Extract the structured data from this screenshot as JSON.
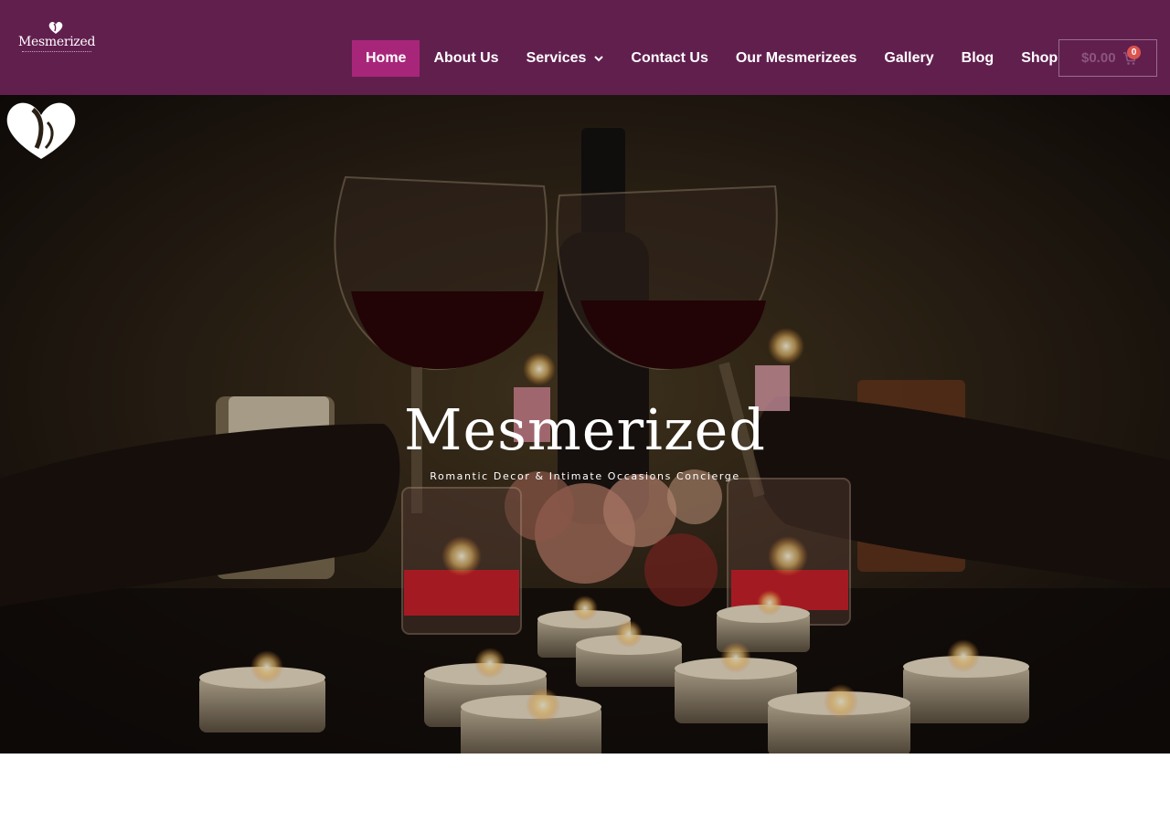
{
  "header": {
    "logo": {
      "name": "Mesmerized",
      "icon": "heart-swirl-logo"
    },
    "nav": [
      {
        "label": "Home",
        "active": true
      },
      {
        "label": "About Us"
      },
      {
        "label": "Services",
        "has_dropdown": true
      },
      {
        "label": "Contact Us"
      },
      {
        "label": "Our Mesmerizees"
      },
      {
        "label": "Gallery"
      },
      {
        "label": "Blog"
      },
      {
        "label": "Shop"
      }
    ],
    "cart": {
      "amount": "$0.00",
      "count": "0",
      "icon": "shopping-cart-icon"
    }
  },
  "hero": {
    "brand": "Mesmerized",
    "tagline": "Romantic Decor & Intimate Occasions Concierge",
    "image": "candlelit-wine-toast"
  },
  "colors": {
    "header_bg": "#611f4e",
    "nav_active_bg": "#a8267a",
    "cart_badge": "#d9534f"
  }
}
